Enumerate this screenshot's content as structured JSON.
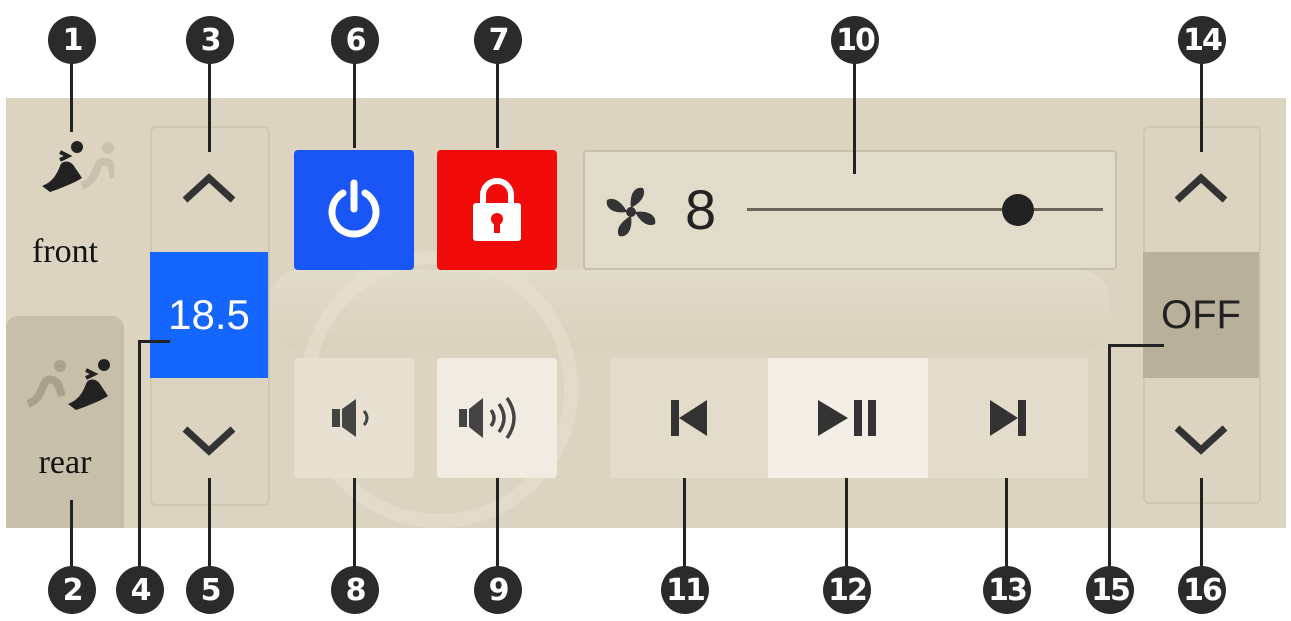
{
  "seats": {
    "front_label": "front",
    "rear_label": "rear"
  },
  "temperature": {
    "value": "18.5"
  },
  "fan": {
    "level": "8",
    "slider_fraction": 0.76
  },
  "right_control": {
    "value": "OFF"
  },
  "buttons": {
    "power": "power-icon",
    "lock": "lock-icon",
    "volume_down": "volume-low-icon",
    "volume_up": "volume-high-icon",
    "previous": "skip-previous-icon",
    "play_pause": "play-pause-icon",
    "next": "skip-next-icon"
  },
  "callouts": {
    "c1": "1",
    "c2": "2",
    "c3": "3",
    "c4": "4",
    "c5": "5",
    "c6": "6",
    "c7": "7",
    "c8": "8",
    "c9": "9",
    "c10": "10",
    "c11": "11",
    "c12": "12",
    "c13": "13",
    "c14": "14",
    "c15": "15",
    "c16": "16"
  },
  "colors": {
    "panel": "#dcd4c0",
    "power": "#1a56f5",
    "lock": "#f20b0b",
    "temperature": "#1565ff"
  }
}
